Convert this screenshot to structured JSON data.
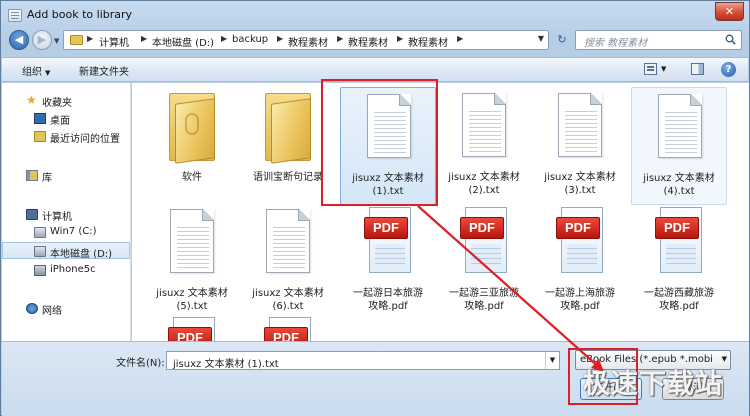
{
  "window": {
    "title": "Add book to library",
    "close_glyph": "✕"
  },
  "nav": {
    "back_glyph": "◀",
    "forward_glyph": "▶"
  },
  "address": {
    "crumbs": [
      "计算机",
      "本地磁盘 (D:)",
      "backup",
      "教程素材",
      "教程素材",
      "教程素材"
    ],
    "refresh_glyph": "↻"
  },
  "search": {
    "placeholder": "搜索 教程素材"
  },
  "toolbar": {
    "organize": "组织",
    "new_folder": "新建文件夹",
    "help": "?"
  },
  "sidebar": {
    "items": [
      {
        "label": "收藏夹",
        "icon": "star-icon"
      },
      {
        "label": "桌面",
        "icon": "desktop-icon"
      },
      {
        "label": "最近访问的位置",
        "icon": "recent-places-icon"
      },
      {
        "label": "库",
        "icon": "library-icon"
      },
      {
        "label": "计算机",
        "icon": "computer-icon"
      },
      {
        "label": "Win7 (C:)",
        "icon": "drive-icon"
      },
      {
        "label": "本地磁盘 (D:)",
        "icon": "drive-icon"
      },
      {
        "label": "iPhone5c",
        "icon": "phone-icon"
      },
      {
        "label": "网络",
        "icon": "network-icon"
      }
    ]
  },
  "files": [
    {
      "name": "软件",
      "type": "folder"
    },
    {
      "name": "语训宝断句记录",
      "type": "folder"
    },
    {
      "name": "jisuxz 文本素材 (1).txt",
      "line1": "jisuxz 文本素材",
      "line2": "(1).txt",
      "type": "txt",
      "selected": true
    },
    {
      "name": "jisuxz 文本素材 (2).txt",
      "line1": "jisuxz 文本素材",
      "line2": "(2).txt",
      "type": "txt"
    },
    {
      "name": "jisuxz 文本素材 (3).txt",
      "line1": "jisuxz 文本素材",
      "line2": "(3).txt",
      "type": "txt"
    },
    {
      "name": "jisuxz 文本素材 (4).txt",
      "line1": "jisuxz 文本素材",
      "line2": "(4).txt",
      "type": "txt"
    },
    {
      "name": "jisuxz 文本素材 (5).txt",
      "line1": "jisuxz 文本素材",
      "line2": "(5).txt",
      "type": "txt"
    },
    {
      "name": "jisuxz 文本素材 (6).txt",
      "line1": "jisuxz 文本素材",
      "line2": "(6).txt",
      "type": "txt"
    },
    {
      "name": "一起游日本旅游攻略.pdf",
      "line1": "一起游日本旅游",
      "line2": "攻略.pdf",
      "type": "pdf"
    },
    {
      "name": "一起游三亚旅游攻略.pdf",
      "line1": "一起游三亚旅游",
      "line2": "攻略.pdf",
      "type": "pdf"
    },
    {
      "name": "一起游上海旅游攻略.pdf",
      "line1": "一起游上海旅游",
      "line2": "攻略.pdf",
      "type": "pdf"
    },
    {
      "name": "一起游西藏旅游攻略.pdf",
      "line1": "一起游西藏旅游",
      "line2": "攻略.pdf",
      "type": "pdf"
    },
    {
      "name": "",
      "type": "pdf"
    },
    {
      "name": "",
      "type": "pdf"
    }
  ],
  "pdf_badge": "PDF",
  "filename": {
    "label": "文件名(N):",
    "value": "jisuxz 文本素材 (1).txt"
  },
  "filetype": {
    "value": "eBook Files (*.epub *.mobi *"
  },
  "buttons": {
    "open": "打开(O)",
    "cancel": "取消"
  },
  "watermark": "极速下载站",
  "colors": {
    "highlight": "#de1f26",
    "selection": "#84acdd"
  }
}
